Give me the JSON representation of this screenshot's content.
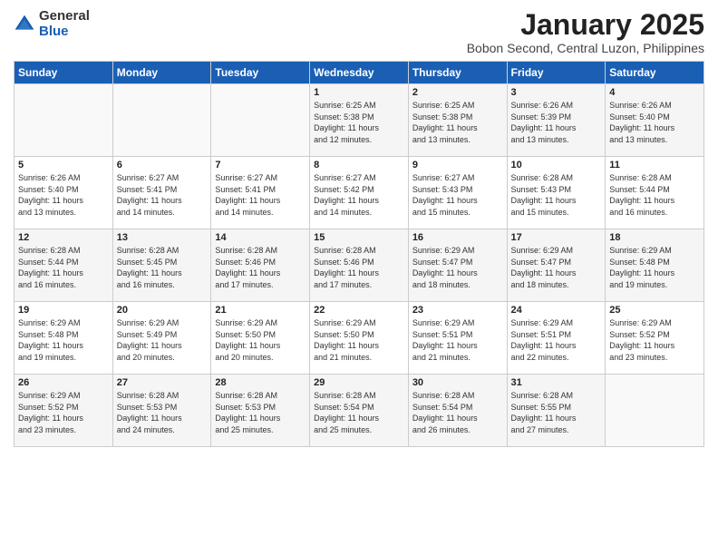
{
  "header": {
    "logo_general": "General",
    "logo_blue": "Blue",
    "month_year": "January 2025",
    "location": "Bobon Second, Central Luzon, Philippines"
  },
  "days_of_week": [
    "Sunday",
    "Monday",
    "Tuesday",
    "Wednesday",
    "Thursday",
    "Friday",
    "Saturday"
  ],
  "weeks": [
    [
      {
        "day": "",
        "info": ""
      },
      {
        "day": "",
        "info": ""
      },
      {
        "day": "",
        "info": ""
      },
      {
        "day": "1",
        "info": "Sunrise: 6:25 AM\nSunset: 5:38 PM\nDaylight: 11 hours\nand 12 minutes."
      },
      {
        "day": "2",
        "info": "Sunrise: 6:25 AM\nSunset: 5:38 PM\nDaylight: 11 hours\nand 13 minutes."
      },
      {
        "day": "3",
        "info": "Sunrise: 6:26 AM\nSunset: 5:39 PM\nDaylight: 11 hours\nand 13 minutes."
      },
      {
        "day": "4",
        "info": "Sunrise: 6:26 AM\nSunset: 5:40 PM\nDaylight: 11 hours\nand 13 minutes."
      }
    ],
    [
      {
        "day": "5",
        "info": "Sunrise: 6:26 AM\nSunset: 5:40 PM\nDaylight: 11 hours\nand 13 minutes."
      },
      {
        "day": "6",
        "info": "Sunrise: 6:27 AM\nSunset: 5:41 PM\nDaylight: 11 hours\nand 14 minutes."
      },
      {
        "day": "7",
        "info": "Sunrise: 6:27 AM\nSunset: 5:41 PM\nDaylight: 11 hours\nand 14 minutes."
      },
      {
        "day": "8",
        "info": "Sunrise: 6:27 AM\nSunset: 5:42 PM\nDaylight: 11 hours\nand 14 minutes."
      },
      {
        "day": "9",
        "info": "Sunrise: 6:27 AM\nSunset: 5:43 PM\nDaylight: 11 hours\nand 15 minutes."
      },
      {
        "day": "10",
        "info": "Sunrise: 6:28 AM\nSunset: 5:43 PM\nDaylight: 11 hours\nand 15 minutes."
      },
      {
        "day": "11",
        "info": "Sunrise: 6:28 AM\nSunset: 5:44 PM\nDaylight: 11 hours\nand 16 minutes."
      }
    ],
    [
      {
        "day": "12",
        "info": "Sunrise: 6:28 AM\nSunset: 5:44 PM\nDaylight: 11 hours\nand 16 minutes."
      },
      {
        "day": "13",
        "info": "Sunrise: 6:28 AM\nSunset: 5:45 PM\nDaylight: 11 hours\nand 16 minutes."
      },
      {
        "day": "14",
        "info": "Sunrise: 6:28 AM\nSunset: 5:46 PM\nDaylight: 11 hours\nand 17 minutes."
      },
      {
        "day": "15",
        "info": "Sunrise: 6:28 AM\nSunset: 5:46 PM\nDaylight: 11 hours\nand 17 minutes."
      },
      {
        "day": "16",
        "info": "Sunrise: 6:29 AM\nSunset: 5:47 PM\nDaylight: 11 hours\nand 18 minutes."
      },
      {
        "day": "17",
        "info": "Sunrise: 6:29 AM\nSunset: 5:47 PM\nDaylight: 11 hours\nand 18 minutes."
      },
      {
        "day": "18",
        "info": "Sunrise: 6:29 AM\nSunset: 5:48 PM\nDaylight: 11 hours\nand 19 minutes."
      }
    ],
    [
      {
        "day": "19",
        "info": "Sunrise: 6:29 AM\nSunset: 5:48 PM\nDaylight: 11 hours\nand 19 minutes."
      },
      {
        "day": "20",
        "info": "Sunrise: 6:29 AM\nSunset: 5:49 PM\nDaylight: 11 hours\nand 20 minutes."
      },
      {
        "day": "21",
        "info": "Sunrise: 6:29 AM\nSunset: 5:50 PM\nDaylight: 11 hours\nand 20 minutes."
      },
      {
        "day": "22",
        "info": "Sunrise: 6:29 AM\nSunset: 5:50 PM\nDaylight: 11 hours\nand 21 minutes."
      },
      {
        "day": "23",
        "info": "Sunrise: 6:29 AM\nSunset: 5:51 PM\nDaylight: 11 hours\nand 21 minutes."
      },
      {
        "day": "24",
        "info": "Sunrise: 6:29 AM\nSunset: 5:51 PM\nDaylight: 11 hours\nand 22 minutes."
      },
      {
        "day": "25",
        "info": "Sunrise: 6:29 AM\nSunset: 5:52 PM\nDaylight: 11 hours\nand 23 minutes."
      }
    ],
    [
      {
        "day": "26",
        "info": "Sunrise: 6:29 AM\nSunset: 5:52 PM\nDaylight: 11 hours\nand 23 minutes."
      },
      {
        "day": "27",
        "info": "Sunrise: 6:28 AM\nSunset: 5:53 PM\nDaylight: 11 hours\nand 24 minutes."
      },
      {
        "day": "28",
        "info": "Sunrise: 6:28 AM\nSunset: 5:53 PM\nDaylight: 11 hours\nand 25 minutes."
      },
      {
        "day": "29",
        "info": "Sunrise: 6:28 AM\nSunset: 5:54 PM\nDaylight: 11 hours\nand 25 minutes."
      },
      {
        "day": "30",
        "info": "Sunrise: 6:28 AM\nSunset: 5:54 PM\nDaylight: 11 hours\nand 26 minutes."
      },
      {
        "day": "31",
        "info": "Sunrise: 6:28 AM\nSunset: 5:55 PM\nDaylight: 11 hours\nand 27 minutes."
      },
      {
        "day": "",
        "info": ""
      }
    ]
  ]
}
